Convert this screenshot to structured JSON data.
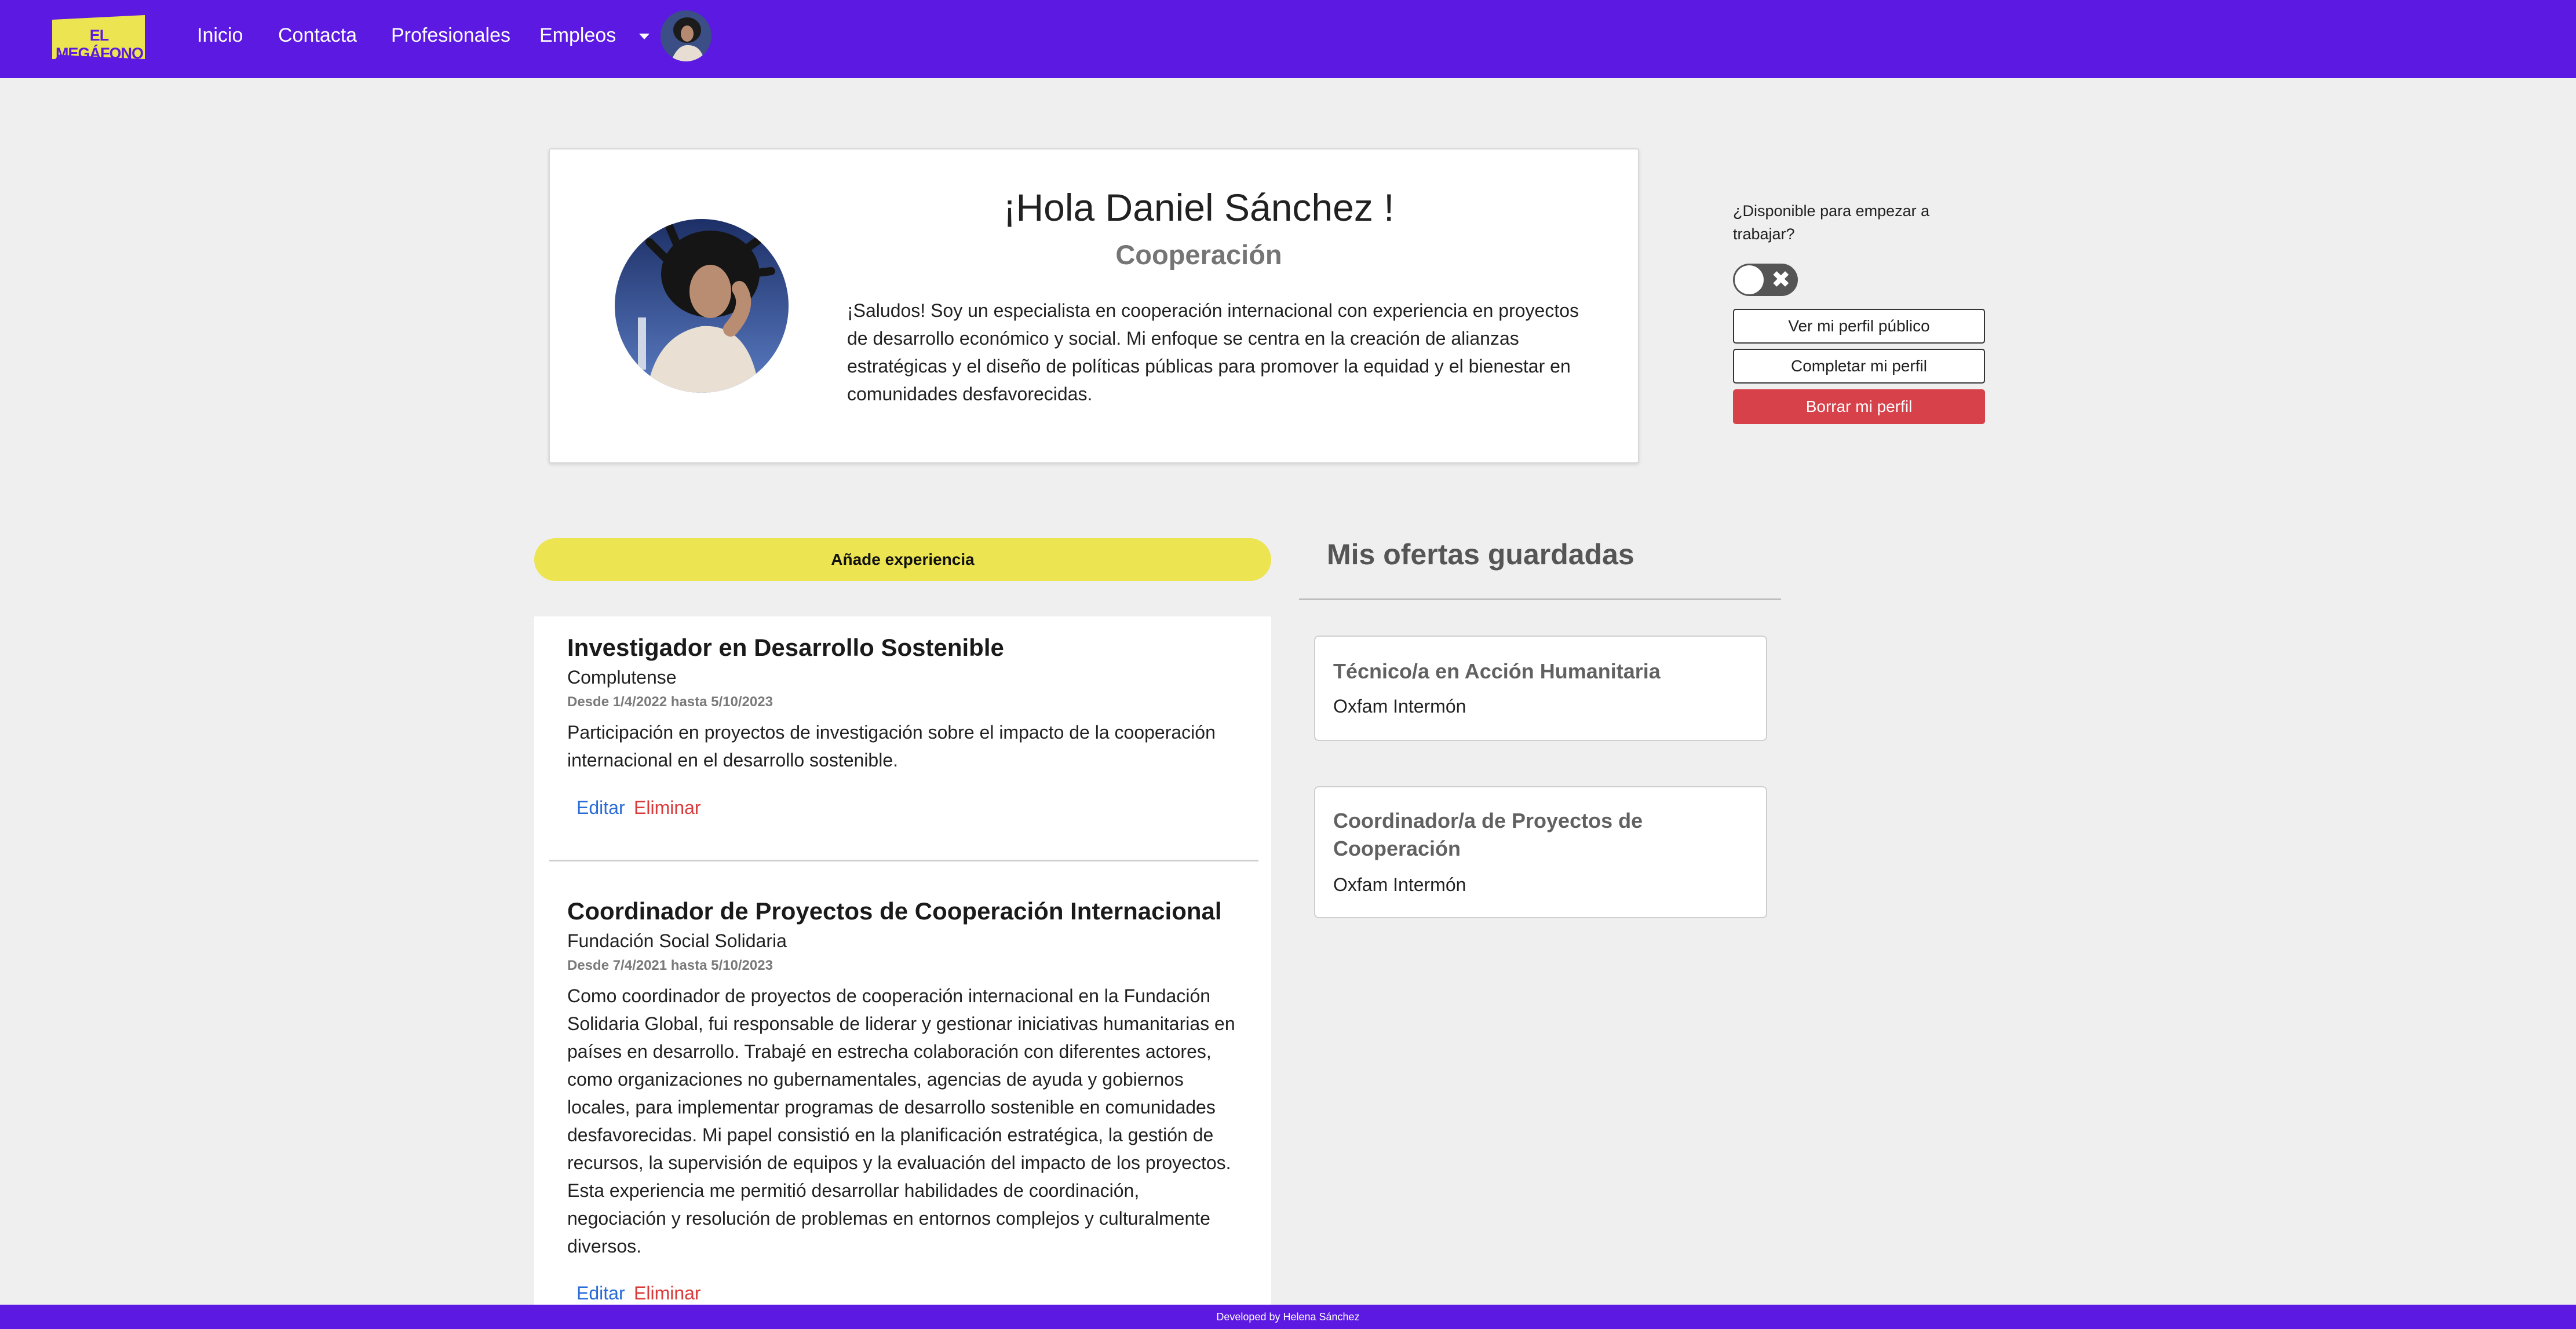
{
  "brand": {
    "logo_text": "EL MEGÁFONO",
    "primary_color": "#5b19e1",
    "accent_color": "#ece450"
  },
  "nav": {
    "links": [
      "Inicio",
      "Contacta",
      "Profesionales",
      "Empleos"
    ],
    "dropdown_icon": "caret-down-icon",
    "avatar_icon": "user-avatar"
  },
  "profile": {
    "greeting": "¡Hola Daniel Sánchez !",
    "profession": "Cooperación",
    "bio": "¡Saludos! Soy un especialista en cooperación internacional con experiencia en proyectos de desarrollo económico y social. Mi enfoque se centra en la creación de alianzas estratégicas y el diseño de políticas públicas para promover la equidad y el bienestar en comunidades desfavorecidas."
  },
  "availability": {
    "label": "¿Disponible para empezar a trabajar?",
    "toggle_state": "off",
    "toggle_icon": "close-icon"
  },
  "actions": {
    "view_public": "Ver mi perfil público",
    "complete": "Completar mi perfil",
    "delete": "Borrar mi perfil",
    "delete_color": "#d7414a"
  },
  "experience": {
    "add_label": "Añade experiencia",
    "items": [
      {
        "title": "Investigador en Desarrollo Sostenible",
        "company": "Complutense",
        "dates": "Desde 1/4/2022 hasta 5/10/2023",
        "description": "Participación en proyectos de investigación sobre el impacto de la cooperación internacional en el desarrollo sostenible.",
        "edit": "Editar",
        "delete": "Eliminar"
      },
      {
        "title": "Coordinador de Proyectos de Cooperación Internacional",
        "company": "Fundación Social Solidaria",
        "dates": "Desde 7/4/2021 hasta 5/10/2023",
        "description": "Como coordinador de proyectos de cooperación internacional en la Fundación Solidaria Global, fui responsable de liderar y gestionar iniciativas humanitarias en países en desarrollo. Trabajé en estrecha colaboración con diferentes actores, como organizaciones no gubernamentales, agencias de ayuda y gobiernos locales, para implementar programas de desarrollo sostenible en comunidades desfavorecidas. Mi papel consistió en la planificación estratégica, la gestión de recursos, la supervisión de equipos y la evaluación del impacto de los proyectos. Esta experiencia me permitió desarrollar habilidades de coordinación, negociación y resolución de problemas en entornos complejos y culturalmente diversos.",
        "edit": "Editar",
        "delete": "Eliminar"
      }
    ]
  },
  "saved_offers": {
    "title": "Mis ofertas guardadas",
    "items": [
      {
        "title": "Técnico/a en Acción Humanitaria",
        "company": "Oxfam Intermón"
      },
      {
        "title": "Coordinador/a de Proyectos de Cooperación",
        "company": "Oxfam Intermón"
      }
    ]
  },
  "footer": {
    "text": "Developed by Helena Sánchez"
  }
}
